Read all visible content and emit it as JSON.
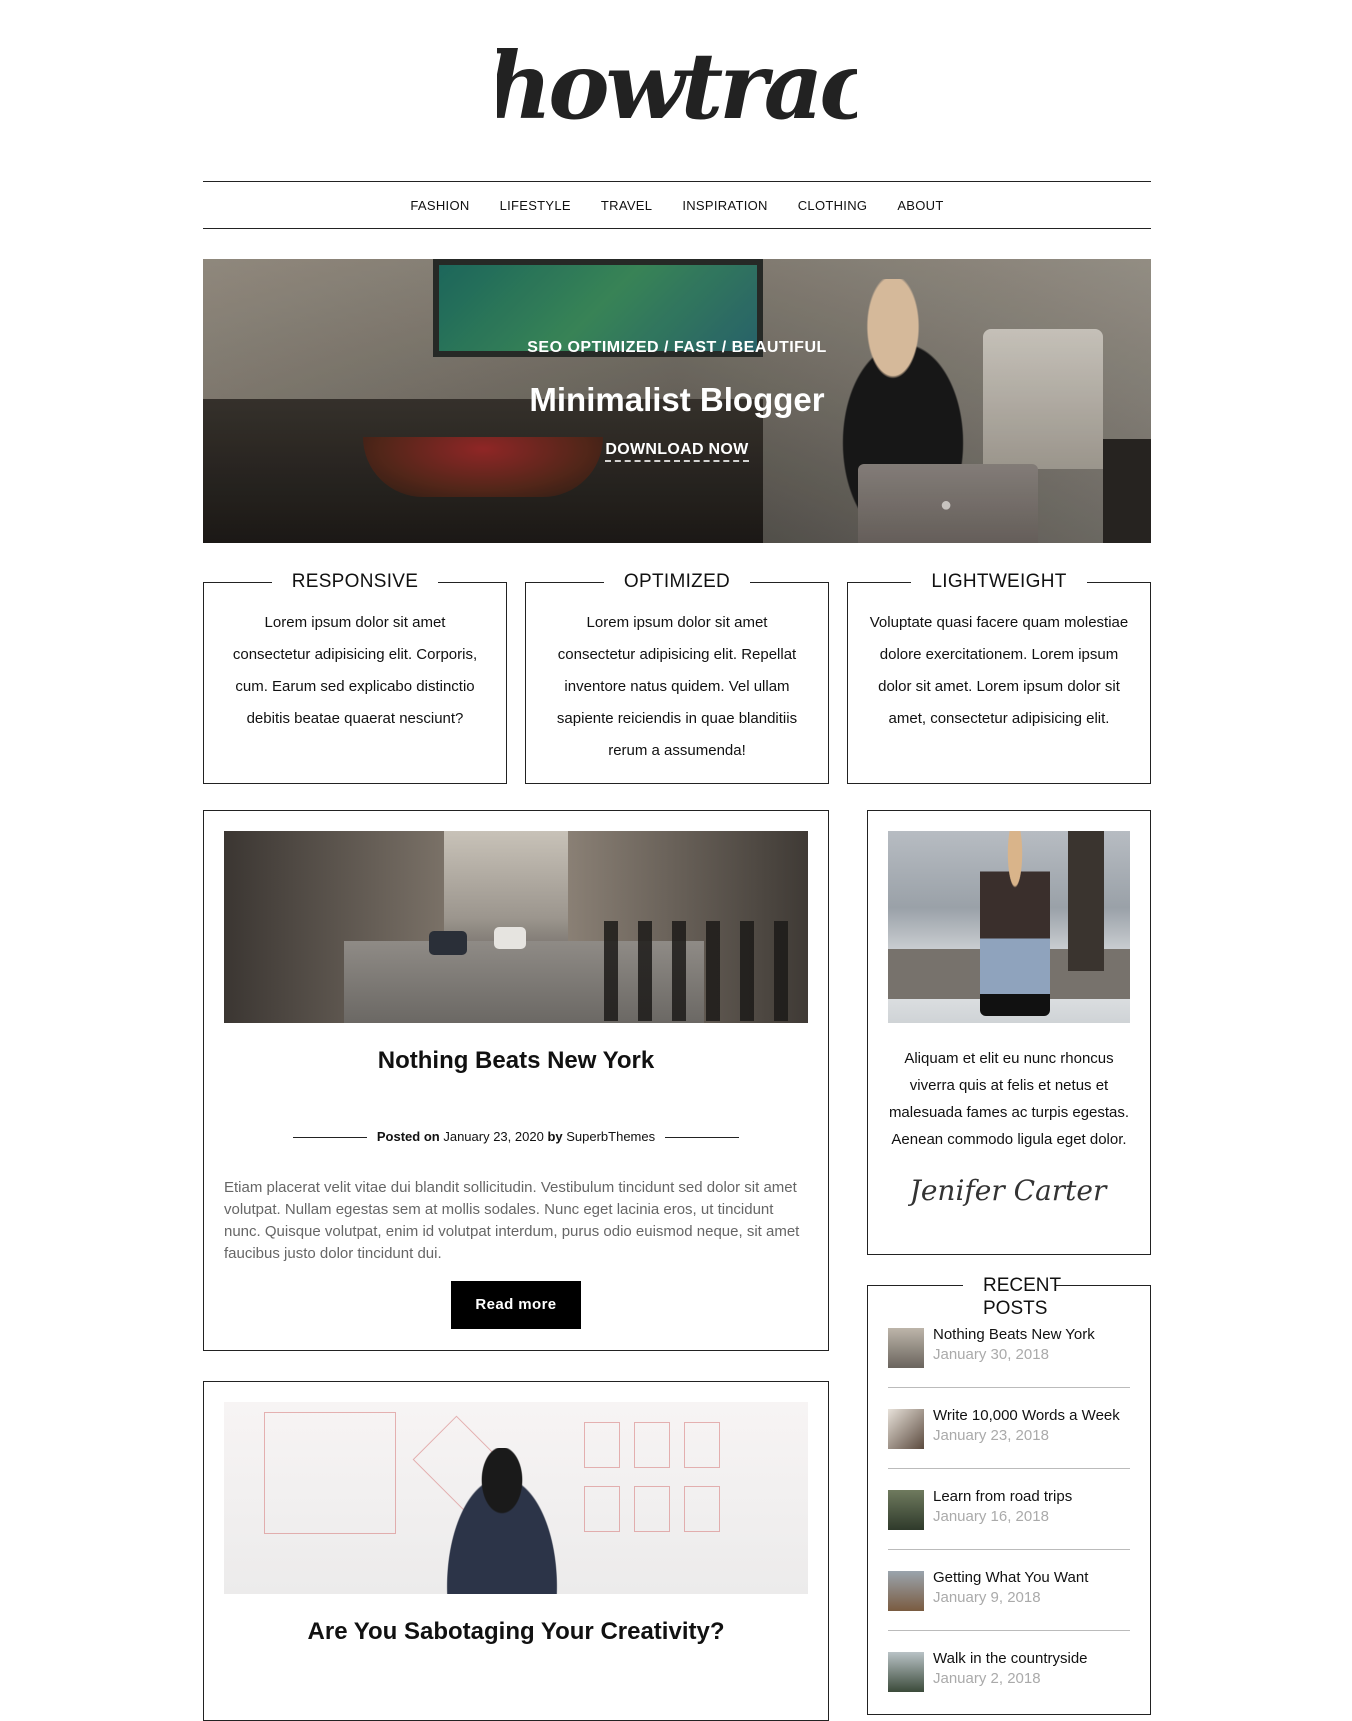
{
  "site": {
    "logo_text": "Showtrack"
  },
  "nav": {
    "items": [
      "FASHION",
      "LIFESTYLE",
      "TRAVEL",
      "INSPIRATION",
      "CLOTHING",
      "ABOUT"
    ]
  },
  "hero": {
    "tagline": "SEO OPTIMIZED / FAST / BEAUTIFUL",
    "title": "Minimalist Blogger",
    "cta": "DOWNLOAD NOW"
  },
  "features": [
    {
      "title": "RESPONSIVE",
      "text": "Lorem ipsum dolor sit amet consectetur adipisicing elit. Corporis, cum. Earum sed explicabo distinctio debitis beatae quaerat nesciunt?"
    },
    {
      "title": "OPTIMIZED",
      "text": "Lorem ipsum dolor sit amet consectetur adipisicing elit. Repellat inventore natus quidem. Vel ullam sapiente reiciendis in quae blanditiis rerum a assumenda!"
    },
    {
      "title": "LIGHTWEIGHT",
      "text": "Voluptate quasi facere quam molestiae dolore exercitationem. Lorem ipsum dolor sit amet. Lorem ipsum dolor sit amet, consectetur adipisicing elit."
    }
  ],
  "posts": [
    {
      "title": "Nothing Beats New York",
      "meta_prefix": "Posted on",
      "date": "January 23, 2020",
      "meta_by": "by",
      "author": "SuperbThemes",
      "excerpt": "Etiam placerat velit vitae dui blandit sollicitudin. Vestibulum tincidunt sed dolor sit amet volutpat. Nullam egestas sem at mollis sodales. Nunc eget lacinia eros, ut tincidunt nunc. Quisque volutpat, enim id volutpat interdum, purus odio euismod neque, sit amet faucibus justo dolor tincidunt dui.",
      "button": "Read more"
    },
    {
      "title": "Are You Sabotaging Your Creativity?"
    }
  ],
  "about_widget": {
    "text": "Aliquam et elit eu nunc rhoncus viverra quis at felis et netus et malesuada fames ac turpis egestas. Aenean commodo ligula eget dolor.",
    "signature": "Jenifer Carter"
  },
  "recent_posts": {
    "title": "RECENT POSTS",
    "items": [
      {
        "title": "Nothing Beats New York",
        "date": "January 30, 2018"
      },
      {
        "title": "Write 10,000 Words a Week",
        "date": "January 23, 2018"
      },
      {
        "title": "Learn from road trips",
        "date": "January 16, 2018"
      },
      {
        "title": "Getting What You Want",
        "date": "January 9, 2018"
      },
      {
        "title": "Walk in the countryside",
        "date": "January 2, 2018"
      }
    ]
  }
}
